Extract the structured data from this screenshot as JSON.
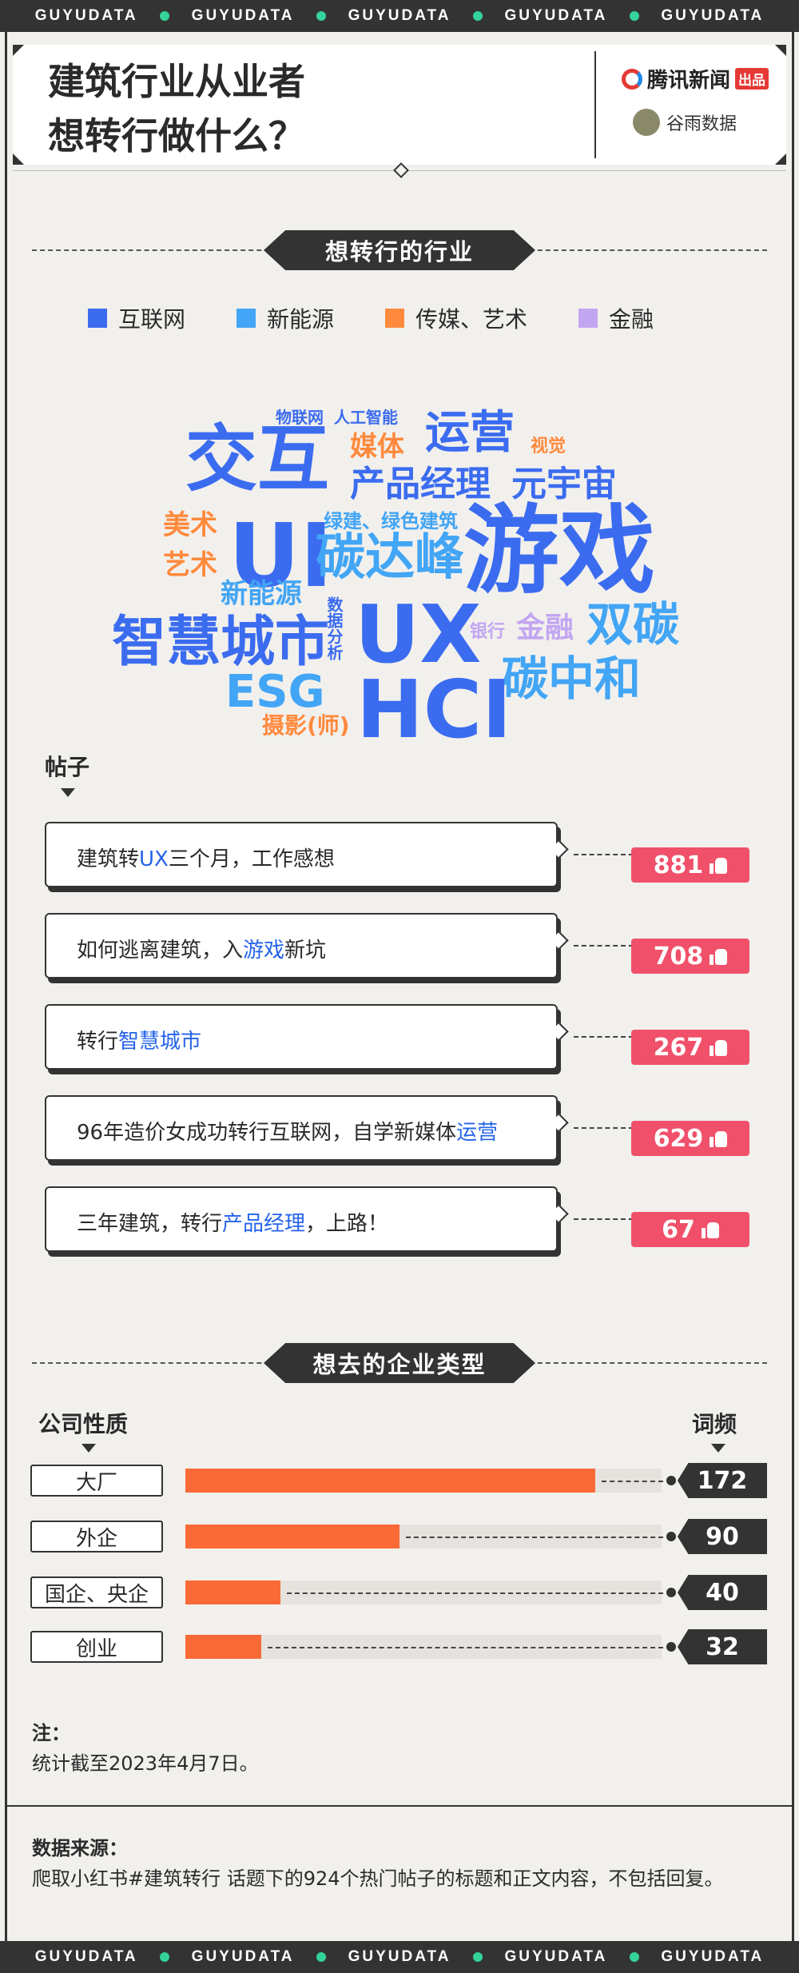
{
  "strip_items": [
    "GUYUDATA",
    "GUYUDATA",
    "GUYUDATA",
    "GUYUDATA",
    "GUYUDATA"
  ],
  "header": {
    "title_line1": "建筑行业从业者",
    "title_line2": "想转行做什么？",
    "brand1": "腾讯新闻",
    "brand1_tag": "出品",
    "brand2": "谷雨数据"
  },
  "section1": {
    "title": "想转行的行业",
    "legend": [
      {
        "label": "互联网",
        "color": "#3b6cf0"
      },
      {
        "label": "新能源",
        "color": "#42a5f5"
      },
      {
        "label": "传媒、艺术",
        "color": "#ff8a3d"
      },
      {
        "label": "金融",
        "color": "#c3a6f2"
      }
    ],
    "posts_label": "帖子"
  },
  "posts": [
    {
      "before": "建筑转",
      "hl": "UX",
      "after": "三个月，工作感想",
      "likes": "881"
    },
    {
      "before": "如何逃离建筑，入",
      "hl": "游戏",
      "after": "新坑",
      "likes": "708"
    },
    {
      "before": "转行",
      "hl": "智慧城市",
      "after": "",
      "likes": "267"
    },
    {
      "before": "96年造价女成功转行互联网，自学新媒体",
      "hl": "运营",
      "after": "",
      "likes": "629"
    },
    {
      "before": "三年建筑，转行",
      "hl": "产品经理",
      "after": "，上路！",
      "likes": "67"
    }
  ],
  "section2": {
    "title": "想去的企业类型",
    "left_header": "公司性质",
    "right_header": "词频"
  },
  "chart_data": [
    {
      "type": "wordcloud",
      "groups": {
        "互联网": "#3b6cf0",
        "新能源": "#42a5f5",
        "传媒、艺术": "#ff8a3d",
        "金融": "#c3a6f2"
      },
      "words": [
        {
          "text": "物联网",
          "group": "互联网"
        },
        {
          "text": "人工智能",
          "group": "互联网"
        },
        {
          "text": "运营",
          "group": "互联网"
        },
        {
          "text": "交互",
          "group": "互联网"
        },
        {
          "text": "媒体",
          "group": "传媒、艺术"
        },
        {
          "text": "视觉",
          "group": "传媒、艺术"
        },
        {
          "text": "产品经理",
          "group": "互联网"
        },
        {
          "text": "元宇宙",
          "group": "互联网"
        },
        {
          "text": "美术",
          "group": "传媒、艺术"
        },
        {
          "text": "UI",
          "group": "互联网"
        },
        {
          "text": "绿建、绿色建筑",
          "group": "新能源"
        },
        {
          "text": "游戏",
          "group": "互联网"
        },
        {
          "text": "艺术",
          "group": "传媒、艺术"
        },
        {
          "text": "碳达峰",
          "group": "新能源"
        },
        {
          "text": "新能源",
          "group": "新能源"
        },
        {
          "text": "数据分析",
          "group": "互联网"
        },
        {
          "text": "UX",
          "group": "互联网"
        },
        {
          "text": "银行",
          "group": "金融"
        },
        {
          "text": "金融",
          "group": "金融"
        },
        {
          "text": "双碳",
          "group": "新能源"
        },
        {
          "text": "智慧城市",
          "group": "互联网"
        },
        {
          "text": "ESG",
          "group": "新能源"
        },
        {
          "text": "碳中和",
          "group": "新能源"
        },
        {
          "text": "HCI",
          "group": "互联网"
        },
        {
          "text": "摄影(师)",
          "group": "传媒、艺术"
        }
      ]
    },
    {
      "type": "bar",
      "orientation": "horizontal",
      "categories": [
        "大厂",
        "外企",
        "国企、央企",
        "创业"
      ],
      "values": [
        172,
        90,
        40,
        32
      ],
      "xlabel": "词频",
      "ylabel": "公司性质",
      "xlim": [
        0,
        200
      ]
    }
  ],
  "bar_labels": [
    "大厂",
    "外企",
    "国企、央企",
    "创业"
  ],
  "note": {
    "heading": "注：",
    "text": "统计截至2023年4月7日。"
  },
  "source": {
    "heading": "数据来源：",
    "text": "爬取小红书#建筑转行 话题下的924个热门帖子的标题和正文内容，不包括回复。"
  }
}
